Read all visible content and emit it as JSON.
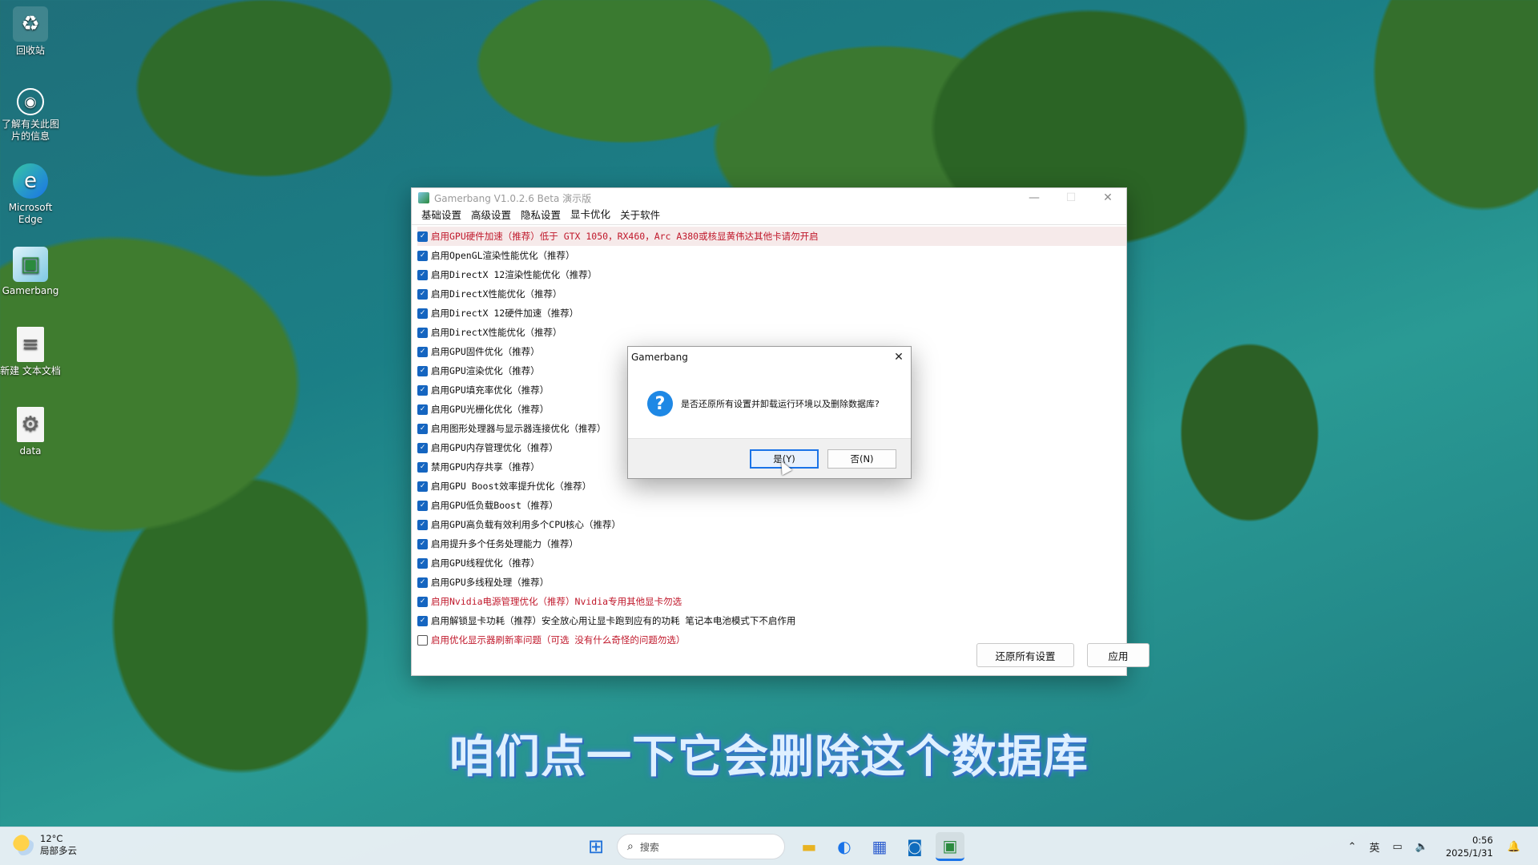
{
  "desktop": {
    "icons": [
      {
        "label": "回收站",
        "icon": "recycle-bin-icon"
      },
      {
        "label": "了解有关此图片的信息",
        "icon": "camera-info-icon"
      },
      {
        "label": "Microsoft Edge",
        "icon": "edge-icon"
      },
      {
        "label": "Gamerbang",
        "icon": "gamerbang-app-icon"
      },
      {
        "label": "新建 文本文档",
        "icon": "text-document-icon"
      },
      {
        "label": "data",
        "icon": "settings-file-icon"
      }
    ]
  },
  "app": {
    "title": "Gamerbang V1.0.2.6 Beta 演示版",
    "tabs": [
      "基础设置",
      "高级设置",
      "隐私设置",
      "显卡优化",
      "关于软件"
    ],
    "active_tab": "显卡优化",
    "options": [
      {
        "label": "启用GPU硬件加速（推荐）低于 GTX 1050，RX460，Arc A380或核显黄伟达其他卡请勿开启",
        "checked": true,
        "warn": true
      },
      {
        "label": "启用OpenGL渲染性能优化（推荐）",
        "checked": true
      },
      {
        "label": "启用DirectX 12渲染性能优化（推荐）",
        "checked": true
      },
      {
        "label": "启用DirectX性能优化（推荐）",
        "checked": true
      },
      {
        "label": "启用DirectX 12硬件加速（推荐）",
        "checked": true
      },
      {
        "label": "启用DirectX性能优化（推荐）",
        "checked": true
      },
      {
        "label": "启用GPU固件优化（推荐）",
        "checked": true
      },
      {
        "label": "启用GPU渲染优化（推荐）",
        "checked": true
      },
      {
        "label": "启用GPU填充率优化（推荐）",
        "checked": true
      },
      {
        "label": "启用GPU光栅化优化（推荐）",
        "checked": true
      },
      {
        "label": "启用图形处理器与显示器连接优化（推荐）",
        "checked": true
      },
      {
        "label": "启用GPU内存管理优化（推荐）",
        "checked": true
      },
      {
        "label": "禁用GPU内存共享（推荐）",
        "checked": true
      },
      {
        "label": "启用GPU Boost效率提升优化（推荐）",
        "checked": true
      },
      {
        "label": "启用GPU低负载Boost（推荐）",
        "checked": true
      },
      {
        "label": "启用GPU高负载有效利用多个CPU核心（推荐）",
        "checked": true
      },
      {
        "label": "启用提升多个任务处理能力（推荐）",
        "checked": true
      },
      {
        "label": "启用GPU线程优化（推荐）",
        "checked": true
      },
      {
        "label": "启用GPU多线程处理（推荐）",
        "checked": true
      },
      {
        "label": "启用Nvidia电源管理优化（推荐）Nvidia专用其他显卡勿选",
        "checked": true,
        "warn": true
      },
      {
        "label": "启用解锁显卡功耗（推荐）安全放心用让显卡跑到应有的功耗 笔记本电池模式下不启作用",
        "checked": true
      },
      {
        "label": "启用优化显示器刷新率问题（可选 没有什么奇怪的问题勿选）",
        "checked": false,
        "warn": true
      }
    ],
    "restore_button": "还原所有设置",
    "apply_button": "应用"
  },
  "dialog": {
    "title": "Gamerbang",
    "message": "是否还原所有设置并卸载运行环境以及删除数据库?",
    "yes_button": "是(Y)",
    "no_button": "否(N)"
  },
  "subtitle": "咱们点一下它会删除这个数据库",
  "taskbar": {
    "weather_temp": "12°C",
    "weather_desc": "局部多云",
    "search_placeholder": "搜索",
    "ime": "英",
    "time": "0:56",
    "date": "2025/1/31"
  },
  "colors": {
    "accent": "#1565c0",
    "warning_text": "#c0182b",
    "subtitle_glow": "#3f7fd4"
  }
}
